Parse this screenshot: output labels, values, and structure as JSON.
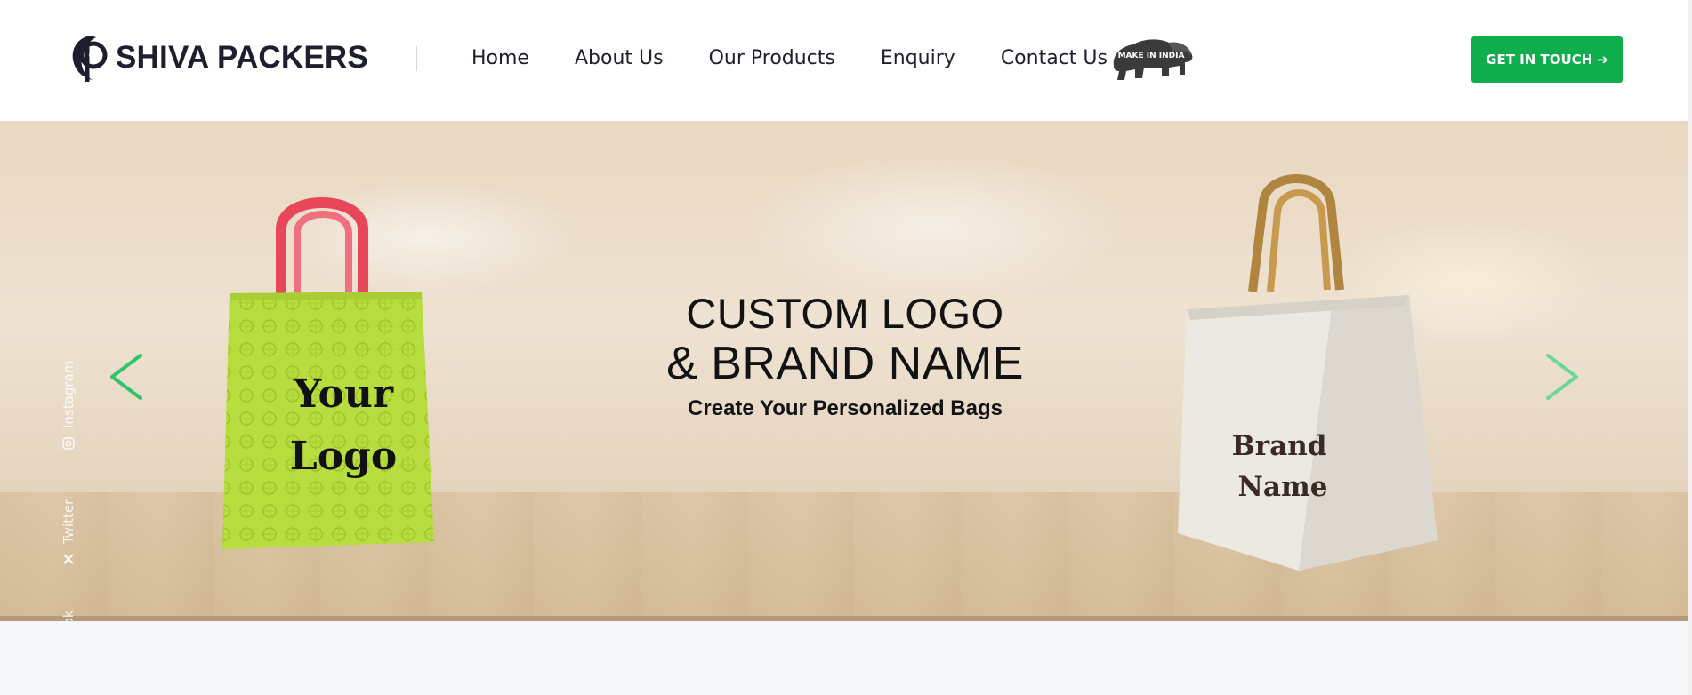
{
  "header": {
    "brand_name": "SHIVA PACKERS",
    "brand_icon": "sp-logo-icon",
    "nav": [
      {
        "label": "Home"
      },
      {
        "label": "About Us"
      },
      {
        "label": "Our Products"
      },
      {
        "label": "Enquiry"
      },
      {
        "label": "Contact Us"
      }
    ],
    "make_in_india_text": "MAKE IN INDIA",
    "cta_label": "GET IN TOUCH",
    "cta_arrow": "➔",
    "colors": {
      "cta": "#0fad4b",
      "text": "#1d1f2e"
    }
  },
  "hero": {
    "headline_line1": "CUSTOM LOGO",
    "headline_line2": "& BRAND NAME",
    "subheadline": "Create Your Personalized Bags",
    "left_bag": {
      "line1": "Your",
      "line2": "Logo",
      "bag_color": "#b8dd3f",
      "handle_color": "#e8475a"
    },
    "right_bag": {
      "line1": "Brand",
      "line2": "Name",
      "bag_color": "#ece9e2",
      "handle_color": "#b0853f"
    },
    "social": [
      {
        "label": "Instagram",
        "icon": "instagram-icon"
      },
      {
        "label": "Twitter",
        "icon": "x-twitter-icon"
      },
      {
        "label": "Facebook",
        "icon": "facebook-icon"
      }
    ],
    "arrow_color": "#2ec46a"
  }
}
